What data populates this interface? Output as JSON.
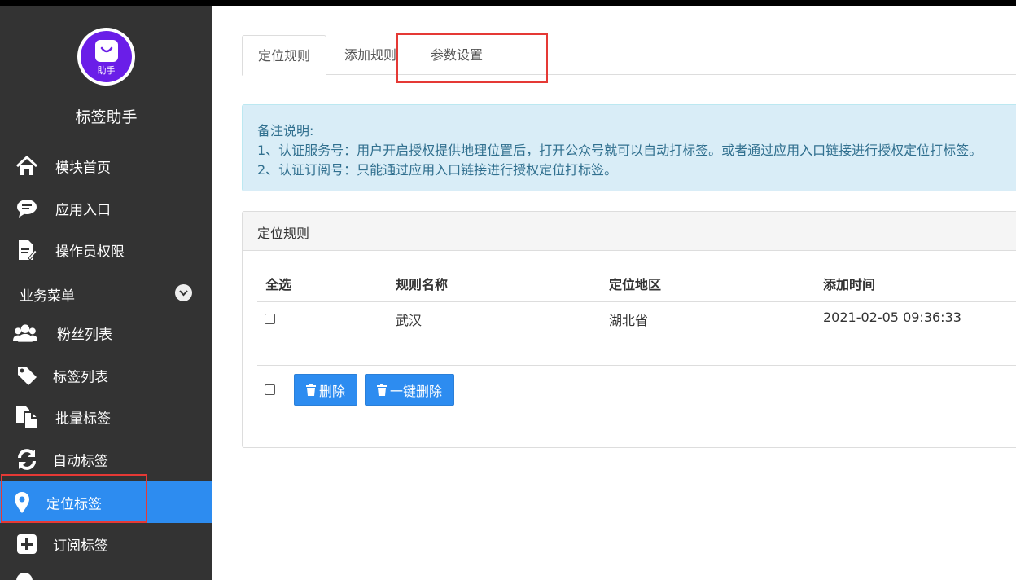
{
  "app": {
    "name": "标签助手",
    "logo_text": "助手"
  },
  "sidebar": {
    "items_top": [
      {
        "label": "模块首页",
        "icon": "home-icon"
      },
      {
        "label": "应用入口",
        "icon": "chat-icon"
      },
      {
        "label": "操作员权限",
        "icon": "edit-doc-icon"
      }
    ],
    "group": {
      "label": "业务菜单",
      "icon": "chevron-down-icon"
    },
    "items_group": [
      {
        "label": "粉丝列表",
        "icon": "users-icon"
      },
      {
        "label": "标签列表",
        "icon": "tag-icon"
      },
      {
        "label": "批量标签",
        "icon": "copy-icon"
      },
      {
        "label": "自动标签",
        "icon": "refresh-icon"
      },
      {
        "label": "定位标签",
        "icon": "location-pin-icon",
        "active": true
      },
      {
        "label": "订阅标签",
        "icon": "plus-square-icon"
      }
    ]
  },
  "tabs": [
    {
      "label": "定位规则",
      "active": true
    },
    {
      "label": "添加规则"
    },
    {
      "label": "参数设置"
    }
  ],
  "notice": {
    "title": "备注说明:",
    "line1": "1、认证服务号：用户开启授权提供地理位置后，打开公众号就可以自动打标签。或者通过应用入口链接进行授权定位打标签。",
    "line2": "2、认证订阅号：只能通过应用入口链接进行授权定位打标签。"
  },
  "panel": {
    "title": "定位规则",
    "columns": [
      "全选",
      "规则名称",
      "定位地区",
      "添加时间"
    ],
    "rows": [
      {
        "name": "武汉",
        "region": "湖北省",
        "time": "2021-02-05 09:36:33",
        "checked": false
      }
    ],
    "actions": {
      "delete_label": "删除",
      "delete_all_label": "一键删除"
    }
  },
  "colors": {
    "sidebar_bg": "#333333",
    "accent": "#2d8cf0",
    "logo_purple": "#6a1ee8",
    "highlight_red": "#e53935",
    "notice_bg": "#d9edf7"
  }
}
